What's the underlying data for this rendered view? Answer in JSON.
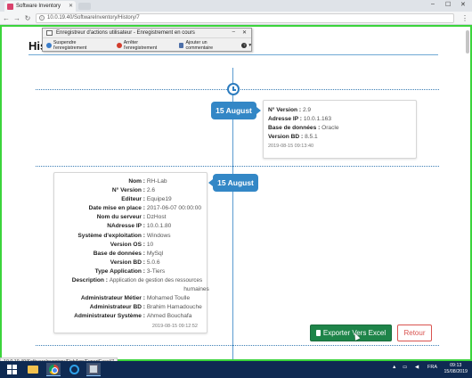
{
  "browser": {
    "tab_title": "Software Inventory",
    "url": "10.0.19.40/SoftwareInventory/History/7",
    "status_url": "10.0.19.40/SoftwareInventory/FichApp/ExportExcel/7"
  },
  "page": {
    "title": "His"
  },
  "recorder": {
    "title": "Enregistreur d'actions utilisateur - Enregistrement en cours",
    "pause_label": "Suspendre l'enregistrement",
    "stop_label": "Arrêter l'enregistrement",
    "comment_label": "Ajouter un commentaire"
  },
  "entries": [
    {
      "date": "15 August",
      "fields": [
        {
          "label": "N° Version :",
          "value": "2.9"
        },
        {
          "label": "Adresse IP :",
          "value": "10.0.1.163"
        },
        {
          "label": "Base de données :",
          "value": "Oracle"
        },
        {
          "label": "Version BD :",
          "value": "8.5.1"
        }
      ],
      "timestamp": "2019-08-15 09:13:40"
    },
    {
      "date": "15 August",
      "fields": [
        {
          "label": "Nom :",
          "value": "RH-Lab"
        },
        {
          "label": "N° Version :",
          "value": "2.6"
        },
        {
          "label": "Editeur :",
          "value": "Equipe19"
        },
        {
          "label": "Date mise en place :",
          "value": "2017-06-07 00:00:00"
        },
        {
          "label": "Nom du serveur :",
          "value": "DzHost"
        },
        {
          "label": "NAdresse IP :",
          "value": "10.0.1.80"
        },
        {
          "label": "Système d'exploitation :",
          "value": "Windows"
        },
        {
          "label": "Version OS :",
          "value": "10"
        },
        {
          "label": "Base de données :",
          "value": "MySql"
        },
        {
          "label": "Version BD :",
          "value": "5.0.6"
        },
        {
          "label": "Type Application :",
          "value": "3-Tiers"
        },
        {
          "label": "Description :",
          "value": "Application de gestion des ressources"
        },
        {
          "label": "",
          "value": "humaines"
        },
        {
          "label": "Administrateur Métier :",
          "value": "Mohamed Toulle"
        },
        {
          "label": "Administrateur BD :",
          "value": "Brahim Hamadouche"
        },
        {
          "label": "Administrateur Système :",
          "value": "Ahmed Bouchafa"
        }
      ],
      "timestamp": "2019-08-15 09:12:52"
    }
  ],
  "buttons": {
    "export": "Exporter Vers Excel",
    "back": "Retour"
  },
  "taskbar": {
    "lang": "FRA",
    "time": "09:13",
    "date": "15/08/2019"
  }
}
